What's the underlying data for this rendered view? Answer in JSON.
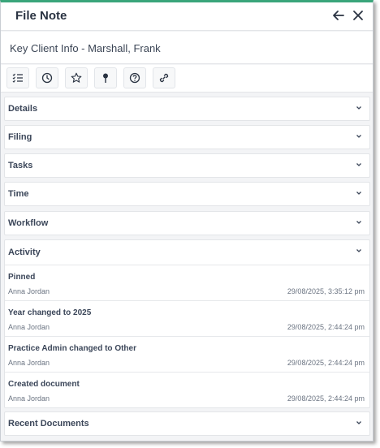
{
  "window": {
    "title": "File Note"
  },
  "document": {
    "title": "Key Client Info - Marshall, Frank"
  },
  "toolbar": {
    "buttons": [
      {
        "icon": "checklist-icon"
      },
      {
        "icon": "clock-icon"
      },
      {
        "icon": "star-icon"
      },
      {
        "icon": "pin-icon"
      },
      {
        "icon": "help-icon"
      },
      {
        "icon": "link-icon"
      }
    ]
  },
  "sections": {
    "details": "Details",
    "filing": "Filing",
    "tasks": "Tasks",
    "time": "Time",
    "workflow": "Workflow",
    "activity": "Activity",
    "recent_documents": "Recent Documents"
  },
  "activity": {
    "items": [
      {
        "action": "Pinned",
        "user": "Anna Jordan",
        "timestamp": "29/08/2025, 3:35:12 pm"
      },
      {
        "action": "Year changed to 2025",
        "user": "Anna Jordan",
        "timestamp": "29/08/2025, 2:44:24 pm"
      },
      {
        "action": "Practice Admin changed to Other",
        "user": "Anna Jordan",
        "timestamp": "29/08/2025, 2:44:24 pm"
      },
      {
        "action": "Created document",
        "user": "Anna Jordan",
        "timestamp": "29/08/2025, 2:44:24 pm"
      }
    ]
  },
  "colors": {
    "accent": "#3aa57a",
    "text": "#2f3a4b",
    "muted": "#6b7482"
  }
}
